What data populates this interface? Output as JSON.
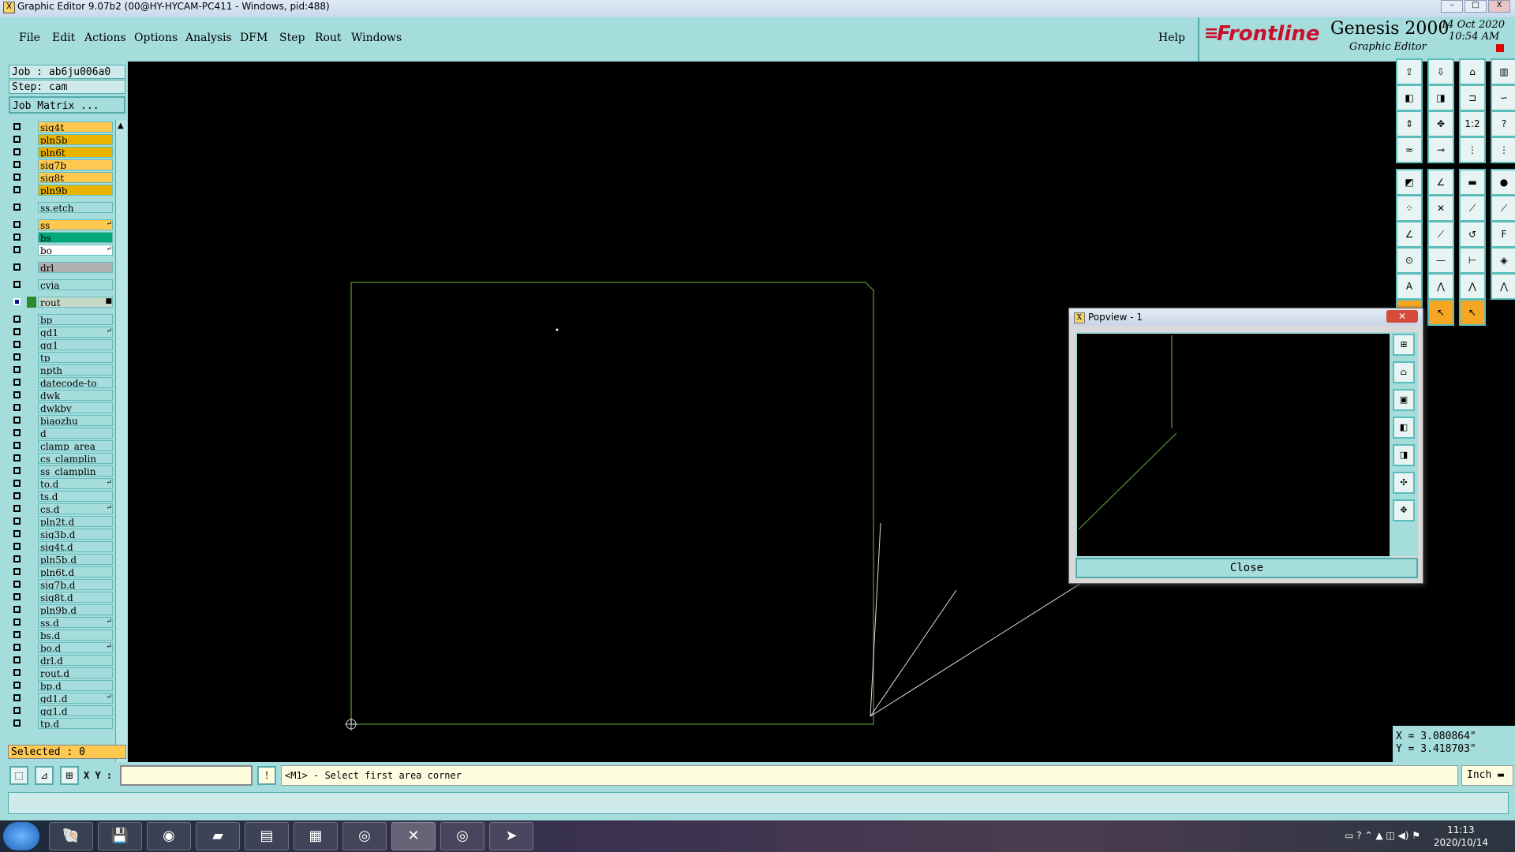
{
  "window": {
    "title": "Graphic Editor 9.07b2 (00@HY-HYCAM-PC411 - Windows, pid:488)",
    "controls": [
      "–",
      "□",
      "X"
    ]
  },
  "menu": {
    "items": [
      "File",
      "Edit",
      "Actions",
      "Options",
      "Analysis",
      "DFM",
      "Step",
      "Rout",
      "Windows"
    ],
    "help": "Help"
  },
  "brand": {
    "logo": "Frontline",
    "product": "Genesis 2000",
    "subtitle": "Graphic Editor",
    "date": "14 Oct 2020",
    "time": "10:54 AM",
    "logo_color": "#c8102e"
  },
  "job": {
    "job_label": "Job : ab6ju006a0",
    "step_label": "Step: cam",
    "matrix_button": "Job Matrix ..."
  },
  "layers": [
    {
      "name": "siq4t",
      "color": "#ffc94f"
    },
    {
      "name": "pln5b",
      "color": "#e8b400"
    },
    {
      "name": "pln6t",
      "color": "#e8b400"
    },
    {
      "name": "siq7b",
      "color": "#ffc94f"
    },
    {
      "name": "siq8t",
      "color": "#ffc94f"
    },
    {
      "name": "pln9b",
      "color": "#e8b400"
    },
    {
      "name": "ss.etch",
      "color": ""
    },
    {
      "name": "ss",
      "color": "#ffc94f",
      "mark": "↵"
    },
    {
      "name": "bs",
      "color": "#00a87a"
    },
    {
      "name": "bo",
      "color": "#ffffff",
      "mark": "↵"
    },
    {
      "name": "drl",
      "color": "#b0b0b0"
    },
    {
      "name": "cvia",
      "color": ""
    },
    {
      "name": "rout",
      "color": "#c7d9c7",
      "mark": "■",
      "active": true
    },
    {
      "name": "bp",
      "color": ""
    },
    {
      "name": "gd1",
      "color": "",
      "mark": "↵"
    },
    {
      "name": "gg1",
      "color": ""
    },
    {
      "name": "tp",
      "color": ""
    },
    {
      "name": "npth",
      "color": ""
    },
    {
      "name": "datecode-to",
      "color": ""
    },
    {
      "name": "dwk",
      "color": ""
    },
    {
      "name": "dwkby",
      "color": ""
    },
    {
      "name": "biaozhu",
      "color": ""
    },
    {
      "name": "d",
      "color": ""
    },
    {
      "name": "clamp_area",
      "color": ""
    },
    {
      "name": "cs_clamplin",
      "color": ""
    },
    {
      "name": "ss_clamplin",
      "color": ""
    },
    {
      "name": "to.d",
      "color": "",
      "mark": "↵"
    },
    {
      "name": "ts.d",
      "color": ""
    },
    {
      "name": "cs.d",
      "color": "",
      "mark": "↵"
    },
    {
      "name": "pln2t.d",
      "color": ""
    },
    {
      "name": "sig3b.d",
      "color": ""
    },
    {
      "name": "siq4t.d",
      "color": ""
    },
    {
      "name": "pln5b.d",
      "color": ""
    },
    {
      "name": "pln6t.d",
      "color": ""
    },
    {
      "name": "siq7b.d",
      "color": ""
    },
    {
      "name": "siq8t.d",
      "color": ""
    },
    {
      "name": "pln9b.d",
      "color": ""
    },
    {
      "name": "ss.d",
      "color": "",
      "mark": "↵"
    },
    {
      "name": "bs.d",
      "color": ""
    },
    {
      "name": "bo.d",
      "color": "",
      "mark": "↵"
    },
    {
      "name": "drl.d",
      "color": ""
    },
    {
      "name": "rout.d",
      "color": ""
    },
    {
      "name": "bp.d",
      "color": ""
    },
    {
      "name": "gd1.d",
      "color": "",
      "mark": "↵"
    },
    {
      "name": "gg1.d",
      "color": ""
    },
    {
      "name": "tp.d",
      "color": ""
    }
  ],
  "selected_label": "Selected : 0",
  "popview": {
    "title": "Popview - 1",
    "close_label": "Close"
  },
  "coords": {
    "x": "X = 3.080864\"",
    "y": "Y = 3.418703\""
  },
  "command": {
    "xy_label": "X Y :",
    "xy_value": "",
    "prompt": "<M1> - Select first area corner",
    "unit": "Inch"
  },
  "taskbar": {
    "time": "11:13",
    "date": "2020/10/14"
  },
  "colors": {
    "panel": "#a5dcdc",
    "outline": "#4a7a2a",
    "highlight": "#ff0000"
  }
}
